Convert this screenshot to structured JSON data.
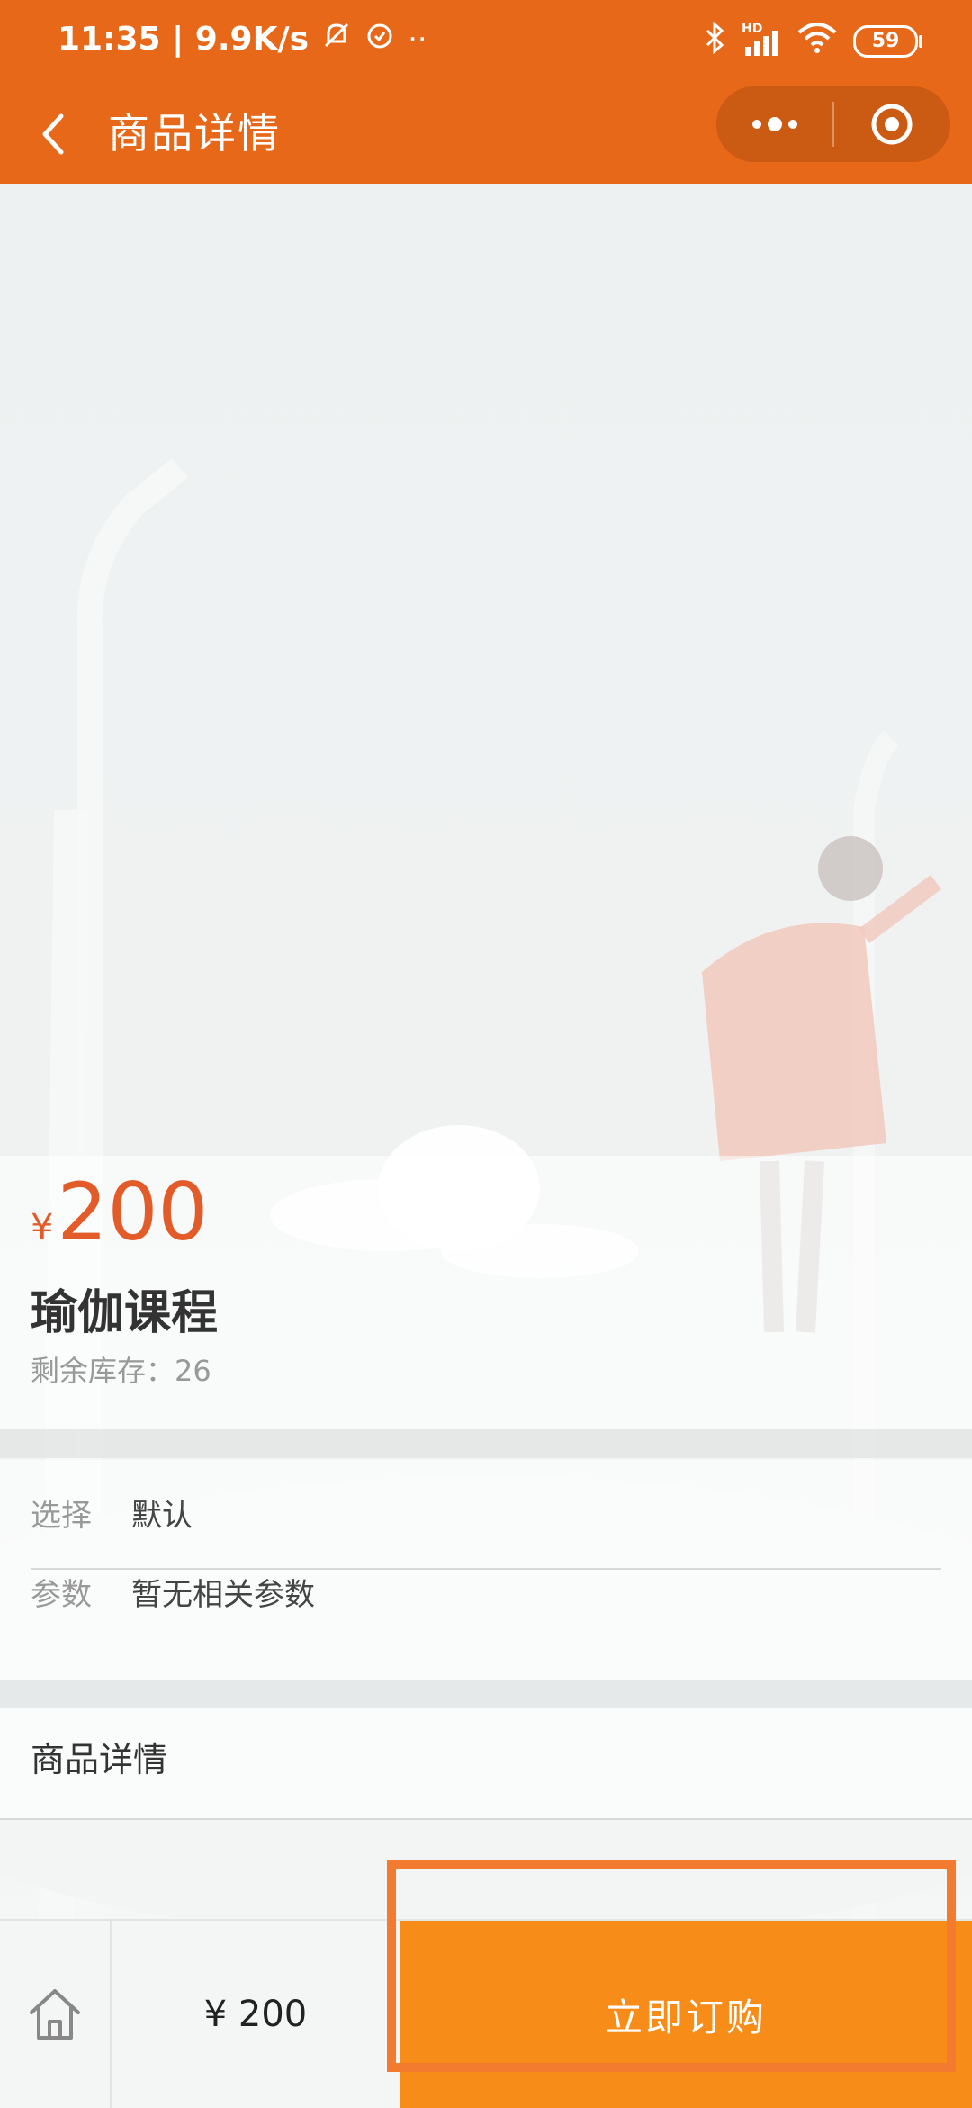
{
  "status_bar": {
    "time_speed": "11:35 | 9.9K/s",
    "overflow_dots": "··",
    "signal_label": "HD",
    "battery": "59"
  },
  "navbar": {
    "title": "商品详情"
  },
  "product": {
    "currency": "¥",
    "price": "200",
    "name": "瑜伽课程",
    "stock_label": "剩余库存：",
    "stock_value": "26"
  },
  "specs": [
    {
      "key": "选择",
      "value": "默认"
    },
    {
      "key": "参数",
      "value": "暂无相关参数"
    }
  ],
  "detail_section": {
    "title": "商品详情"
  },
  "bottom_bar": {
    "price": "¥ 200",
    "order_label": "立即订购"
  },
  "colors": {
    "header": "#e8681a",
    "price": "#e25b28",
    "order_button": "#f88c18",
    "highlight": "#f27b30"
  }
}
